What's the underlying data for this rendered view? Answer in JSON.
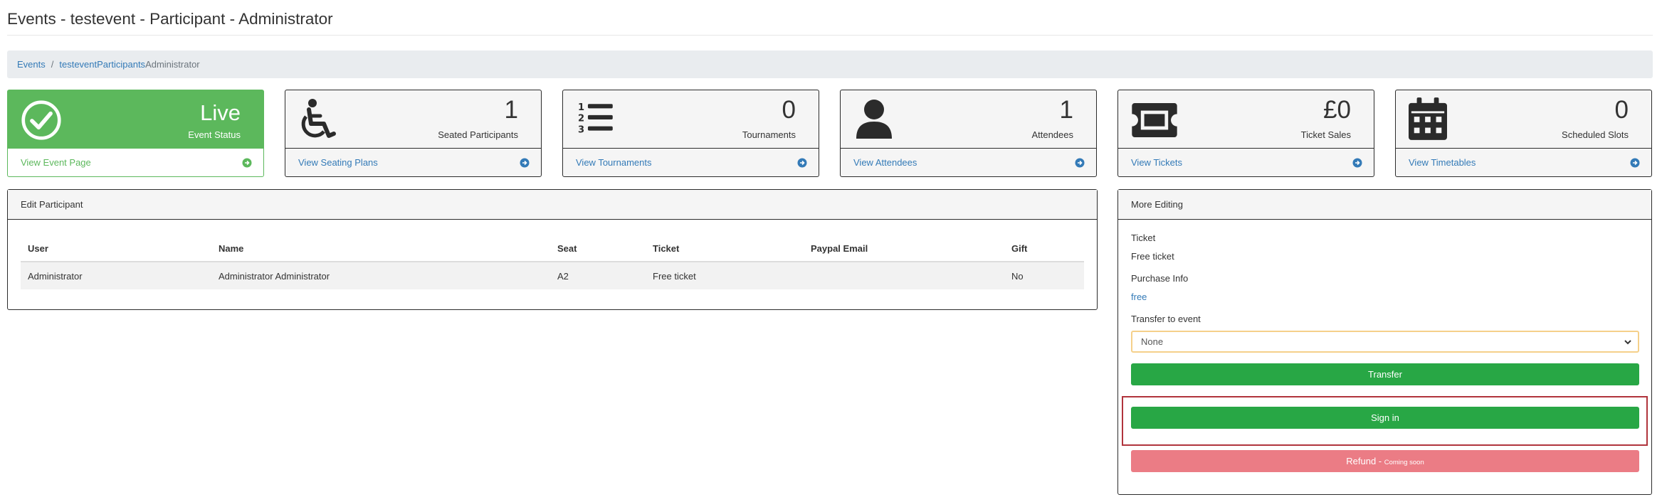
{
  "page": {
    "title": "Events - testevent - Participant - Administrator"
  },
  "breadcrumb": {
    "events": "Events",
    "separator": "/",
    "event": "testevent",
    "participants": "Participants",
    "current": "Administrator"
  },
  "cards": [
    {
      "value": "Live",
      "label": "Event Status",
      "link": "View Event Page",
      "icon": "check-circle-icon"
    },
    {
      "value": "1",
      "label": "Seated Participants",
      "link": "View Seating Plans",
      "icon": "wheelchair-icon"
    },
    {
      "value": "0",
      "label": "Tournaments",
      "link": "View Tournaments",
      "icon": "list-ol-icon"
    },
    {
      "value": "1",
      "label": "Attendees",
      "link": "View Attendees",
      "icon": "user-icon"
    },
    {
      "value": "£0",
      "label": "Ticket Sales",
      "link": "View Tickets",
      "icon": "ticket-icon"
    },
    {
      "value": "0",
      "label": "Scheduled Slots",
      "link": "View Timetables",
      "icon": "calendar-icon"
    }
  ],
  "edit_participant": {
    "title": "Edit Participant",
    "columns": [
      "User",
      "Name",
      "Seat",
      "Ticket",
      "Paypal Email",
      "Gift"
    ],
    "rows": [
      [
        "Administrator",
        "Administrator Administrator",
        "A2",
        "Free ticket",
        "",
        "No"
      ]
    ]
  },
  "more_editing": {
    "title": "More Editing",
    "ticket_label": "Ticket",
    "ticket_value": "Free ticket",
    "purchase_label": "Purchase Info",
    "purchase_value": "free",
    "transfer_label": "Transfer to event",
    "transfer_selected": "None",
    "transfer_button": "Transfer",
    "signin_button": "Sign in",
    "refund_button": "Refund - ",
    "refund_note": "Coming soon"
  },
  "colors": {
    "live_green": "#5cb85c",
    "link_blue": "#337ab7",
    "button_green": "#28a745",
    "button_red": "#eb7c85",
    "highlight_red": "#b0343c"
  }
}
